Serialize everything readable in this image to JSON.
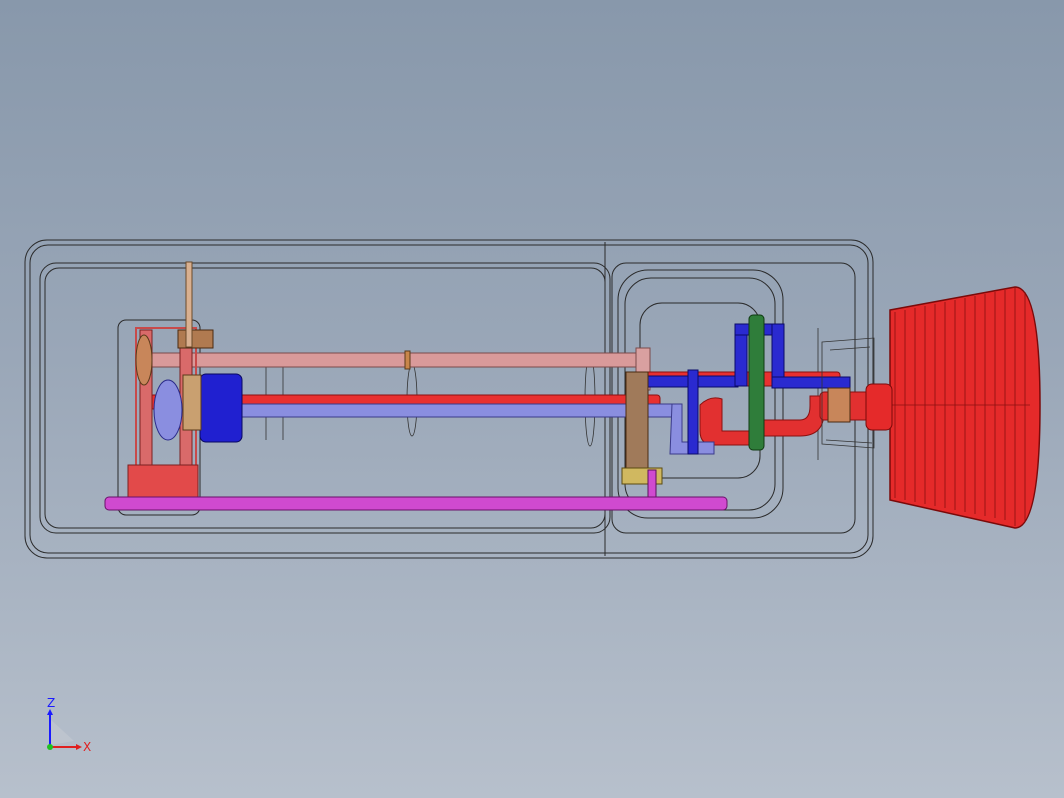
{
  "viewport": {
    "background_top": "#8898ab",
    "background_bottom": "#b7c0cc"
  },
  "model": {
    "outline_color": "#2a2a2a",
    "parts": [
      {
        "name": "red-intake-shaft",
        "color": "#e83030"
      },
      {
        "name": "blue-lavender-shaft",
        "color": "#8a8ee0"
      },
      {
        "name": "pink-rod",
        "color": "#d99a9a"
      },
      {
        "name": "magenta-rod",
        "color": "#d04ad0"
      },
      {
        "name": "blue-cylinder",
        "color": "#2020d0"
      },
      {
        "name": "green-plate",
        "color": "#2f7d3a"
      },
      {
        "name": "brown-bracket",
        "color": "#a07a5a"
      },
      {
        "name": "red-fan",
        "color": "#e52a2a"
      }
    ]
  },
  "triad": {
    "z_label": "Z",
    "x_label": "X"
  }
}
